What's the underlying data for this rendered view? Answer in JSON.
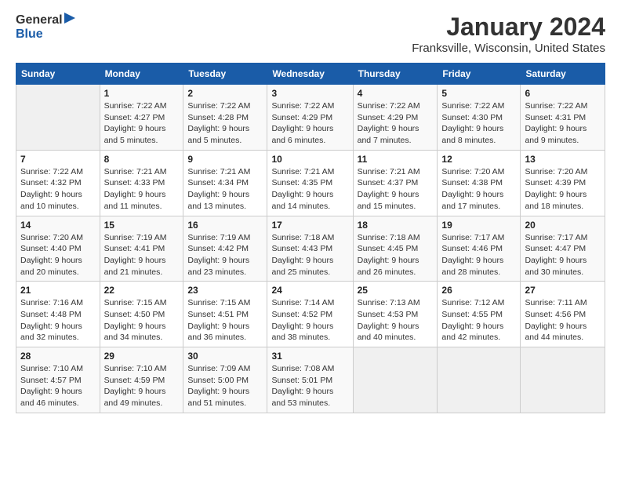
{
  "header": {
    "logo_line1": "General",
    "logo_line2": "Blue",
    "title": "January 2024",
    "subtitle": "Franksville, Wisconsin, United States"
  },
  "days_of_week": [
    "Sunday",
    "Monday",
    "Tuesday",
    "Wednesday",
    "Thursday",
    "Friday",
    "Saturday"
  ],
  "weeks": [
    [
      {
        "day": "",
        "info": ""
      },
      {
        "day": "1",
        "info": "Sunrise: 7:22 AM\nSunset: 4:27 PM\nDaylight: 9 hours\nand 5 minutes."
      },
      {
        "day": "2",
        "info": "Sunrise: 7:22 AM\nSunset: 4:28 PM\nDaylight: 9 hours\nand 5 minutes."
      },
      {
        "day": "3",
        "info": "Sunrise: 7:22 AM\nSunset: 4:29 PM\nDaylight: 9 hours\nand 6 minutes."
      },
      {
        "day": "4",
        "info": "Sunrise: 7:22 AM\nSunset: 4:29 PM\nDaylight: 9 hours\nand 7 minutes."
      },
      {
        "day": "5",
        "info": "Sunrise: 7:22 AM\nSunset: 4:30 PM\nDaylight: 9 hours\nand 8 minutes."
      },
      {
        "day": "6",
        "info": "Sunrise: 7:22 AM\nSunset: 4:31 PM\nDaylight: 9 hours\nand 9 minutes."
      }
    ],
    [
      {
        "day": "7",
        "info": "Sunrise: 7:22 AM\nSunset: 4:32 PM\nDaylight: 9 hours\nand 10 minutes."
      },
      {
        "day": "8",
        "info": "Sunrise: 7:21 AM\nSunset: 4:33 PM\nDaylight: 9 hours\nand 11 minutes."
      },
      {
        "day": "9",
        "info": "Sunrise: 7:21 AM\nSunset: 4:34 PM\nDaylight: 9 hours\nand 13 minutes."
      },
      {
        "day": "10",
        "info": "Sunrise: 7:21 AM\nSunset: 4:35 PM\nDaylight: 9 hours\nand 14 minutes."
      },
      {
        "day": "11",
        "info": "Sunrise: 7:21 AM\nSunset: 4:37 PM\nDaylight: 9 hours\nand 15 minutes."
      },
      {
        "day": "12",
        "info": "Sunrise: 7:20 AM\nSunset: 4:38 PM\nDaylight: 9 hours\nand 17 minutes."
      },
      {
        "day": "13",
        "info": "Sunrise: 7:20 AM\nSunset: 4:39 PM\nDaylight: 9 hours\nand 18 minutes."
      }
    ],
    [
      {
        "day": "14",
        "info": "Sunrise: 7:20 AM\nSunset: 4:40 PM\nDaylight: 9 hours\nand 20 minutes."
      },
      {
        "day": "15",
        "info": "Sunrise: 7:19 AM\nSunset: 4:41 PM\nDaylight: 9 hours\nand 21 minutes."
      },
      {
        "day": "16",
        "info": "Sunrise: 7:19 AM\nSunset: 4:42 PM\nDaylight: 9 hours\nand 23 minutes."
      },
      {
        "day": "17",
        "info": "Sunrise: 7:18 AM\nSunset: 4:43 PM\nDaylight: 9 hours\nand 25 minutes."
      },
      {
        "day": "18",
        "info": "Sunrise: 7:18 AM\nSunset: 4:45 PM\nDaylight: 9 hours\nand 26 minutes."
      },
      {
        "day": "19",
        "info": "Sunrise: 7:17 AM\nSunset: 4:46 PM\nDaylight: 9 hours\nand 28 minutes."
      },
      {
        "day": "20",
        "info": "Sunrise: 7:17 AM\nSunset: 4:47 PM\nDaylight: 9 hours\nand 30 minutes."
      }
    ],
    [
      {
        "day": "21",
        "info": "Sunrise: 7:16 AM\nSunset: 4:48 PM\nDaylight: 9 hours\nand 32 minutes."
      },
      {
        "day": "22",
        "info": "Sunrise: 7:15 AM\nSunset: 4:50 PM\nDaylight: 9 hours\nand 34 minutes."
      },
      {
        "day": "23",
        "info": "Sunrise: 7:15 AM\nSunset: 4:51 PM\nDaylight: 9 hours\nand 36 minutes."
      },
      {
        "day": "24",
        "info": "Sunrise: 7:14 AM\nSunset: 4:52 PM\nDaylight: 9 hours\nand 38 minutes."
      },
      {
        "day": "25",
        "info": "Sunrise: 7:13 AM\nSunset: 4:53 PM\nDaylight: 9 hours\nand 40 minutes."
      },
      {
        "day": "26",
        "info": "Sunrise: 7:12 AM\nSunset: 4:55 PM\nDaylight: 9 hours\nand 42 minutes."
      },
      {
        "day": "27",
        "info": "Sunrise: 7:11 AM\nSunset: 4:56 PM\nDaylight: 9 hours\nand 44 minutes."
      }
    ],
    [
      {
        "day": "28",
        "info": "Sunrise: 7:10 AM\nSunset: 4:57 PM\nDaylight: 9 hours\nand 46 minutes."
      },
      {
        "day": "29",
        "info": "Sunrise: 7:10 AM\nSunset: 4:59 PM\nDaylight: 9 hours\nand 49 minutes."
      },
      {
        "day": "30",
        "info": "Sunrise: 7:09 AM\nSunset: 5:00 PM\nDaylight: 9 hours\nand 51 minutes."
      },
      {
        "day": "31",
        "info": "Sunrise: 7:08 AM\nSunset: 5:01 PM\nDaylight: 9 hours\nand 53 minutes."
      },
      {
        "day": "",
        "info": ""
      },
      {
        "day": "",
        "info": ""
      },
      {
        "day": "",
        "info": ""
      }
    ]
  ]
}
